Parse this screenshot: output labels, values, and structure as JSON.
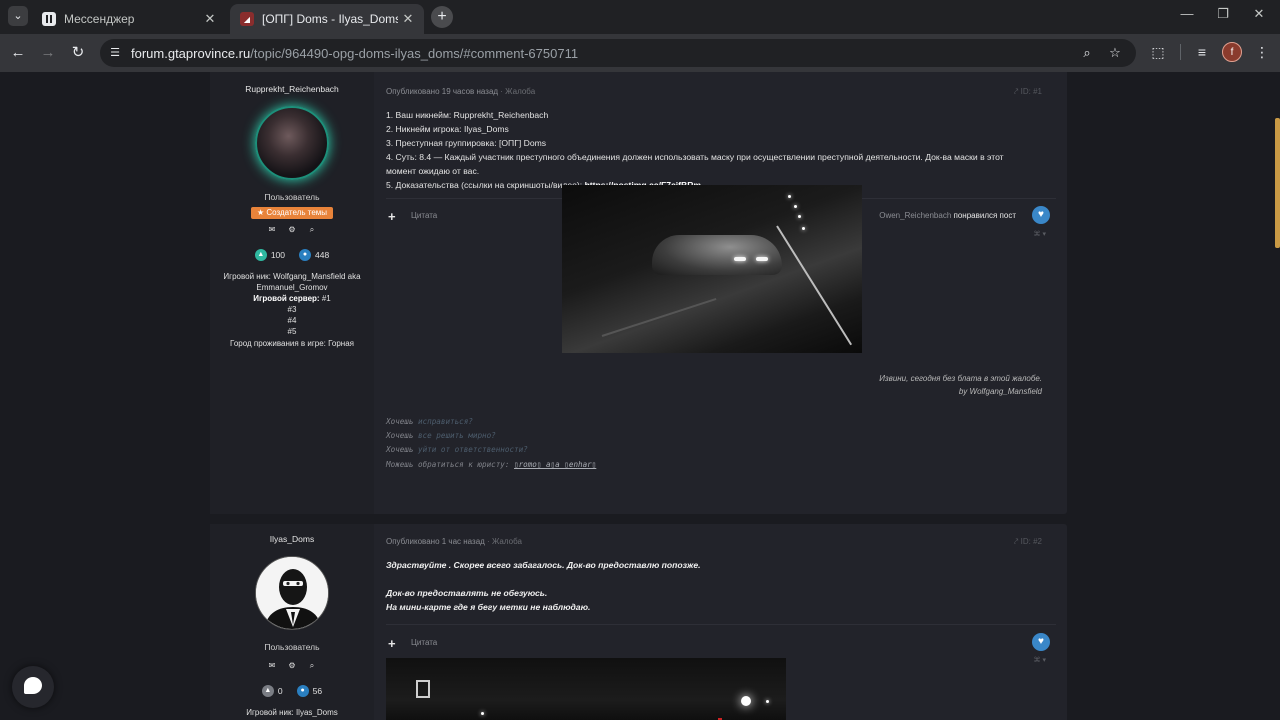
{
  "tabs": [
    {
      "title": "Мессенджер",
      "close": "✕"
    },
    {
      "title": "[ОПГ] Doms - Ilyas_Doms - Все",
      "close": "✕"
    }
  ],
  "browser": {
    "url_host": "forum.gtaprovince.ru",
    "url_path": "/topic/964490-opg-doms-ilyas_doms/#comment-6750711",
    "profile_initial": "f"
  },
  "posts": [
    {
      "author": "Rupprekht_Reichenbach",
      "role": "Пользователь",
      "badge": "★ Создатель темы",
      "reputation": "100",
      "messages": "448",
      "info": [
        "Игровой ник: Wolfgang_Mansfield aka",
        "Emmanuel_Gromov"
      ],
      "server_label": "Игровой сервер:",
      "servers": [
        "#1",
        "#3",
        "#4",
        "#5"
      ],
      "city": "Город проживания в игре: Горная",
      "meta": "Опубликовано 19 часов назад",
      "report": " · Жалоба",
      "post_id": "ID: #1",
      "body": [
        "1. Ваш никнейм: Rupprekht_Reichenbach",
        "2. Никнейм игрока: Ilyas_Doms",
        "3. Преступная группировка: [ОПГ] Doms",
        "4. Суть: 8.4 — Каждый участник преступного объединения должен использовать маску при осуществлении преступной деятельности. Док-ва маски в этот",
        "момент ожидаю от вас.",
        "5. Доказательства (ссылки на скриншоты/видео): "
      ],
      "proof_link": "https://postimg.cc/F7cjfBRm",
      "quote_label": "Цитата",
      "liker": "Owen_Reichenbach",
      "liked_text": " понравился пост",
      "signature_caption": [
        "Извини, сегодня без блата в этой жалобе.",
        "by Wolfgang_Mansfield"
      ],
      "signature_lines": [
        {
          "lead": "Хочешь ",
          "accent": "исправиться?"
        },
        {
          "lead": "Хочешь ",
          "accent": "все решить мирно?"
        },
        {
          "lead": "Хочешь ",
          "accent": "уйти от ответственности?"
        }
      ],
      "signature_contact": "Можешь обратиться к юристу: ",
      "signature_contact_link": "▯romo▯ a▯a ▯enhar▯"
    },
    {
      "author": "Ilyas_Doms",
      "role": "Пользователь",
      "reputation": "0",
      "messages": "56",
      "info_first": "Игровой ник: Ilyas_Doms",
      "meta": "Опубликовано 1 час назад",
      "report": " · Жалоба",
      "post_id": "ID: #2",
      "body": [
        "Здраствуйте . Скорее всего забагалось. Док-во предоставлю попозже.",
        "",
        "Док-во предоставлять не обезуюсь.",
        "На мини-карте где я бегу метки не наблюдаю."
      ],
      "quote_label": "Цитата"
    }
  ],
  "icons": {
    "message": "✉",
    "gear": "⚙",
    "search": "⌕",
    "share": "⤤",
    "heart": "♥",
    "plus": "+"
  }
}
